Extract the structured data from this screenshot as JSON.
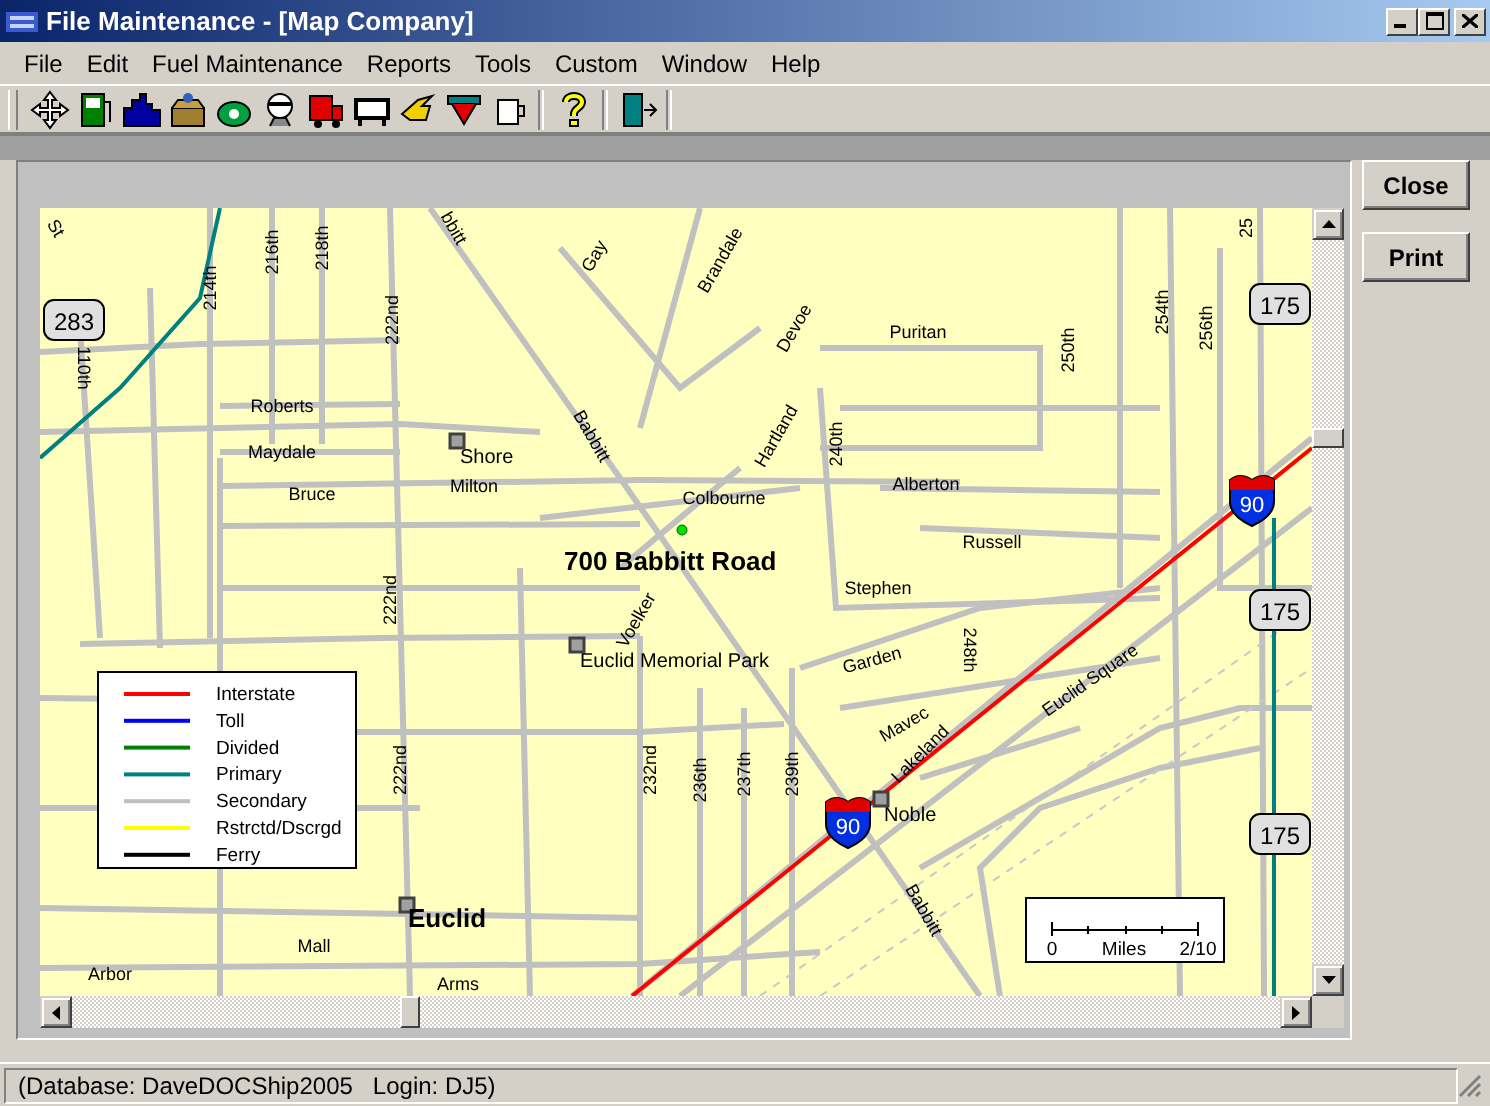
{
  "window": {
    "title": "File Maintenance - [Map Company]"
  },
  "menu": [
    {
      "label": "File"
    },
    {
      "label": "Edit"
    },
    {
      "label": "Fuel Maintenance"
    },
    {
      "label": "Reports"
    },
    {
      "label": "Tools"
    },
    {
      "label": "Custom"
    },
    {
      "label": "Window"
    },
    {
      "label": "Help"
    }
  ],
  "map": {
    "location": "700 Babbitt Road",
    "labels": [
      {
        "text": "St",
        "kind": "street"
      },
      {
        "text": "214th",
        "kind": "street"
      },
      {
        "text": "216th",
        "kind": "street"
      },
      {
        "text": "218th",
        "kind": "street"
      },
      {
        "text": "222nd",
        "kind": "street"
      },
      {
        "text": "bbitt",
        "kind": "street"
      },
      {
        "text": "Gay",
        "kind": "street"
      },
      {
        "text": "Brandale",
        "kind": "street"
      },
      {
        "text": "110th",
        "kind": "street"
      },
      {
        "text": "Roberts",
        "kind": "street"
      },
      {
        "text": "Maydale",
        "kind": "street"
      },
      {
        "text": "Bruce",
        "kind": "street"
      },
      {
        "text": "Shore",
        "kind": "place"
      },
      {
        "text": "Milton",
        "kind": "street"
      },
      {
        "text": "Babbitt",
        "kind": "street"
      },
      {
        "text": "Devoe",
        "kind": "street"
      },
      {
        "text": "Puritan",
        "kind": "street"
      },
      {
        "text": "Hartland",
        "kind": "street"
      },
      {
        "text": "240th",
        "kind": "street"
      },
      {
        "text": "Colbourne",
        "kind": "street"
      },
      {
        "text": "Alberton",
        "kind": "street"
      },
      {
        "text": "250th",
        "kind": "street"
      },
      {
        "text": "254th",
        "kind": "street"
      },
      {
        "text": "256th",
        "kind": "street"
      },
      {
        "text": "25",
        "kind": "street"
      },
      {
        "text": "Russell",
        "kind": "street"
      },
      {
        "text": "Voelker",
        "kind": "street"
      },
      {
        "text": "Stephen",
        "kind": "street"
      },
      {
        "text": "Euclid Memorial Park",
        "kind": "place"
      },
      {
        "text": "222nd",
        "kind": "street"
      },
      {
        "text": "222nd",
        "kind": "street"
      },
      {
        "text": "232nd",
        "kind": "street"
      },
      {
        "text": "236th",
        "kind": "street"
      },
      {
        "text": "237th",
        "kind": "street"
      },
      {
        "text": "239th",
        "kind": "street"
      },
      {
        "text": "248th",
        "kind": "street"
      },
      {
        "text": "Garden",
        "kind": "street"
      },
      {
        "text": "Mavec",
        "kind": "street"
      },
      {
        "text": "Lakeland",
        "kind": "street"
      },
      {
        "text": "Noble",
        "kind": "place"
      },
      {
        "text": "Euclid Square",
        "kind": "street"
      },
      {
        "text": "Babbitt",
        "kind": "street"
      },
      {
        "text": "Euclid",
        "kind": "city"
      },
      {
        "text": "Mall",
        "kind": "street"
      },
      {
        "text": "Arbor",
        "kind": "street"
      },
      {
        "text": "Arms",
        "kind": "street"
      }
    ],
    "shields": [
      {
        "text": "283",
        "kind": "route"
      },
      {
        "text": "175",
        "kind": "route"
      },
      {
        "text": "175",
        "kind": "route"
      },
      {
        "text": "175",
        "kind": "route"
      },
      {
        "text": "90",
        "kind": "interstate"
      },
      {
        "text": "90",
        "kind": "interstate"
      }
    ],
    "legend": [
      {
        "label": "Interstate",
        "color": "#ff0000"
      },
      {
        "label": "Toll",
        "color": "#0000ff"
      },
      {
        "label": "Divided",
        "color": "#008000"
      },
      {
        "label": "Primary",
        "color": "#008080"
      },
      {
        "label": "Secondary",
        "color": "#c0c0c0"
      },
      {
        "label": "Rstrctd/Dscrgd",
        "color": "#ffff00"
      },
      {
        "label": "Ferry",
        "color": "#000000"
      }
    ],
    "scale": {
      "start": "0",
      "unit": "Miles",
      "end": "2/10"
    }
  },
  "buttons": [
    {
      "label": "Close"
    },
    {
      "label": "Print"
    }
  ],
  "status_bar": "(Database: DaveDOCShip2005   Login: DJ5)"
}
